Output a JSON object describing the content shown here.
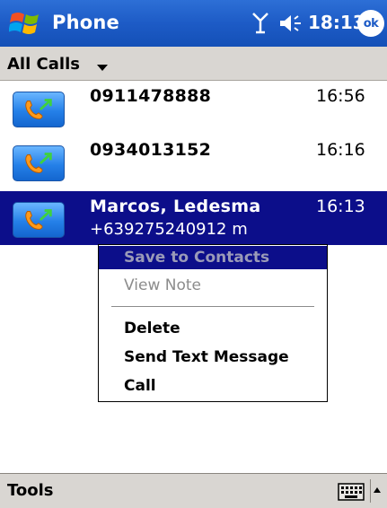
{
  "titlebar": {
    "app_title": "Phone",
    "clock": "18:13",
    "ok_label": "ok",
    "logo_icon": "windows-flag-icon",
    "signal_icon": "antenna-signal-icon",
    "volume_icon": "speaker-volume-icon"
  },
  "filter": {
    "label": "All Calls"
  },
  "calls": [
    {
      "name": "0911478888",
      "time": "16:56",
      "number": "",
      "icon": "outgoing-call-icon"
    },
    {
      "name": "0934013152",
      "time": "16:16",
      "number": "",
      "icon": "outgoing-call-icon"
    },
    {
      "name": "Marcos, Ledesma",
      "time": "16:13",
      "number": "+639275240912 m",
      "icon": "outgoing-call-icon"
    }
  ],
  "context_menu": {
    "items": [
      {
        "label": "Save to Contacts",
        "state": "highlighted"
      },
      {
        "label": "View Note",
        "state": "disabled"
      },
      {
        "label": "Delete",
        "state": "enabled"
      },
      {
        "label": "Send Text Message",
        "state": "enabled"
      },
      {
        "label": "Call",
        "state": "enabled"
      }
    ]
  },
  "bottombar": {
    "tools_label": "Tools",
    "keyboard_icon": "keyboard-icon",
    "sip_icon": "up-arrow-icon"
  },
  "colors": {
    "titlebar": "#1d5bc6",
    "selection": "#0c0e8a",
    "bars": "#d9d6d2"
  }
}
